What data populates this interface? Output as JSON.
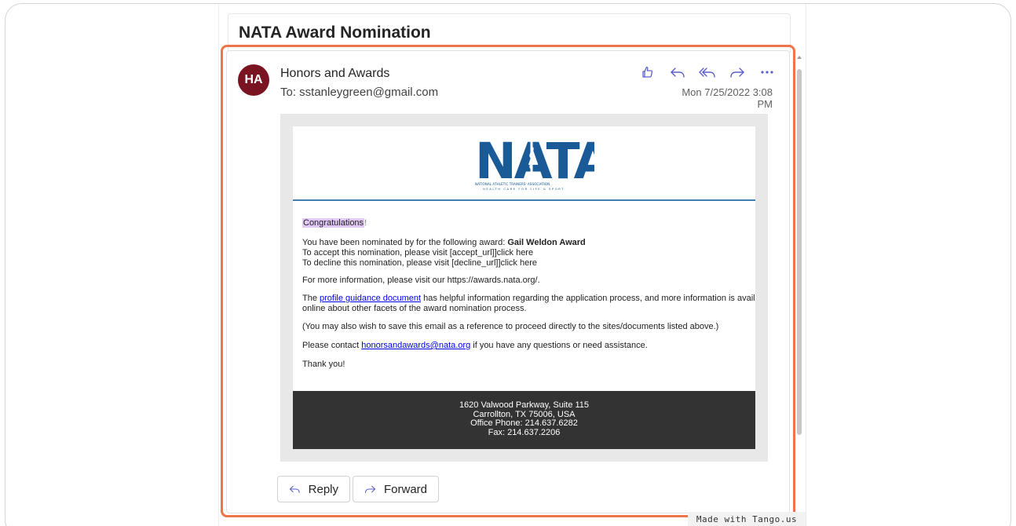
{
  "email": {
    "subject": "NATA Award Nomination",
    "avatar_initials": "HA",
    "sender_name": "Honors and Awards",
    "to_line": "To:  sstanleygreen@gmail.com",
    "date": "Mon 7/25/2022 3:08 PM",
    "actions": [
      "like-icon",
      "reply-icon",
      "reply-all-icon",
      "forward-icon",
      "more-icon"
    ]
  },
  "body": {
    "logo_text": "NATA",
    "logo_tagline": "NATIONAL ATHLETIC TRAINERS' ASSOCIATION",
    "logo_subtagline": "HEALTH CARE FOR LIFE & SPORT",
    "congrats": "Congratulations",
    "congrats_bang": "!",
    "nominated_prefix": "You have been nominated by for the following award: ",
    "award_name": "Gail Weldon Award",
    "accept_line": "To accept this nomination, please visit [accept_url]]click here",
    "decline_line": "To decline this nomination, please visit [decline_url]]click here",
    "more_info": "For more information, please visit our https://awards.nata.org/.",
    "profile_prefix": "The ",
    "profile_link": "profile guidance document",
    "profile_suffix": " has helpful information regarding the application process, and more information is availal",
    "profile_line2": "online about other facets of the award nomination process.",
    "save_note": "(You may also wish to save this email as a reference to proceed directly to the sites/documents listed above.)",
    "contact_prefix": "Please contact ",
    "contact_email": "honorsandawards@nata.org",
    "contact_suffix": " if you have any questions or need assistance.",
    "thanks": "Thank you!"
  },
  "footer": {
    "address1": "1620 Valwood Parkway, Suite 115",
    "address2": "Carrollton, TX 75006, USA",
    "phone": "Office Phone: 214.637.6282",
    "fax": "Fax: 214.637.2206"
  },
  "buttons": {
    "reply": "Reply",
    "forward": "Forward"
  },
  "badge": "Made with Tango.us",
  "colors": {
    "highlight_border": "#f0744a",
    "avatar_bg": "#7a1422",
    "action_icon": "#5b5fc7",
    "nata_blue": "#1a5a96"
  }
}
